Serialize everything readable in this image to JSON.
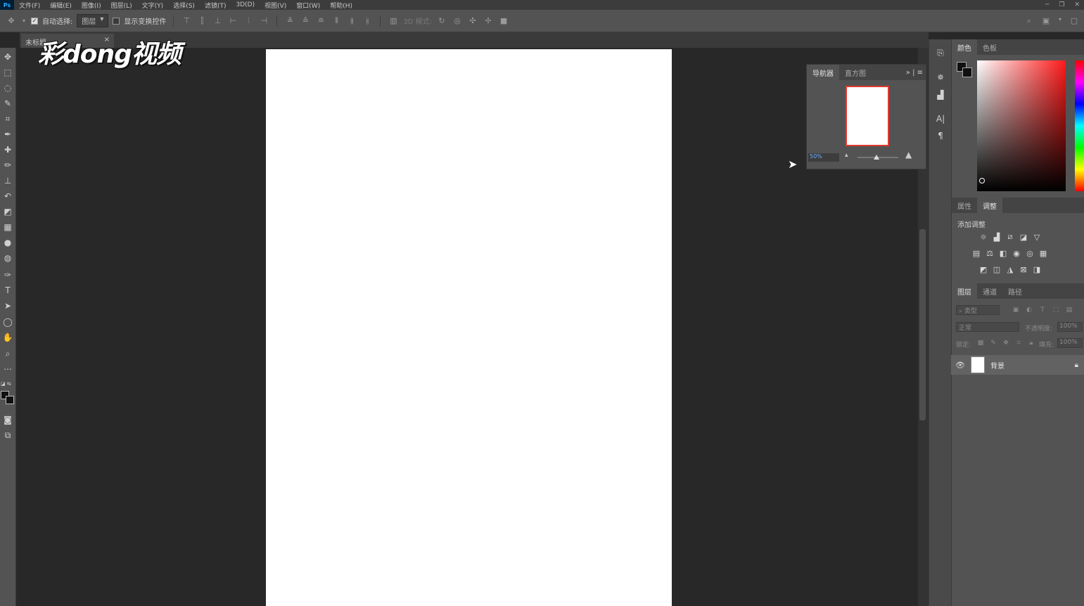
{
  "menubar": {
    "logo": "Ps",
    "items": [
      "文件(F)",
      "编辑(E)",
      "图像(I)",
      "图层(L)",
      "文字(Y)",
      "选择(S)",
      "滤镜(T)",
      "3D(D)",
      "视图(V)",
      "窗口(W)",
      "帮助(H)"
    ]
  },
  "options": {
    "auto_select_label": "自动选择:",
    "auto_select_value": "图层",
    "show_transform_label": "显示变换控件",
    "mode_3d_label": "3D 模式:"
  },
  "document": {
    "tab_title": "未标题",
    "background_color": "#ffffff"
  },
  "watermark": "彩dong视频",
  "navigator": {
    "tabs": [
      "导航器",
      "直方图"
    ],
    "zoom": "50%"
  },
  "color_panel": {
    "tabs": [
      "颜色",
      "色板"
    ],
    "foreground": "#111111",
    "background": "#111111",
    "hue": "#ff1a1a"
  },
  "adjust_panel": {
    "tabs": [
      "属性",
      "调整"
    ],
    "add_label": "添加调整"
  },
  "layers_panel": {
    "tabs": [
      "图层",
      "通道",
      "路径"
    ],
    "filter_placeholder": "类型",
    "blend_mode": "正常",
    "opacity_label": "不透明度:",
    "opacity_value": "100%",
    "lock_label": "锁定:",
    "fill_label": "填充:",
    "fill_value": "100%",
    "layers": [
      {
        "name": "背景",
        "visible": true,
        "locked": true
      }
    ]
  },
  "icons": {
    "tools": [
      "move-icon",
      "marquee-icon",
      "lasso-icon",
      "quick-select-icon",
      "crop-icon",
      "eyedropper-icon",
      "healing-icon",
      "brush-icon",
      "stamp-icon",
      "history-brush-icon",
      "eraser-icon",
      "gradient-icon",
      "blur-icon",
      "dodge-icon",
      "pen-icon",
      "type-icon",
      "path-select-icon",
      "ellipse-icon",
      "hand-icon",
      "zoom-icon",
      "more-icon"
    ]
  }
}
